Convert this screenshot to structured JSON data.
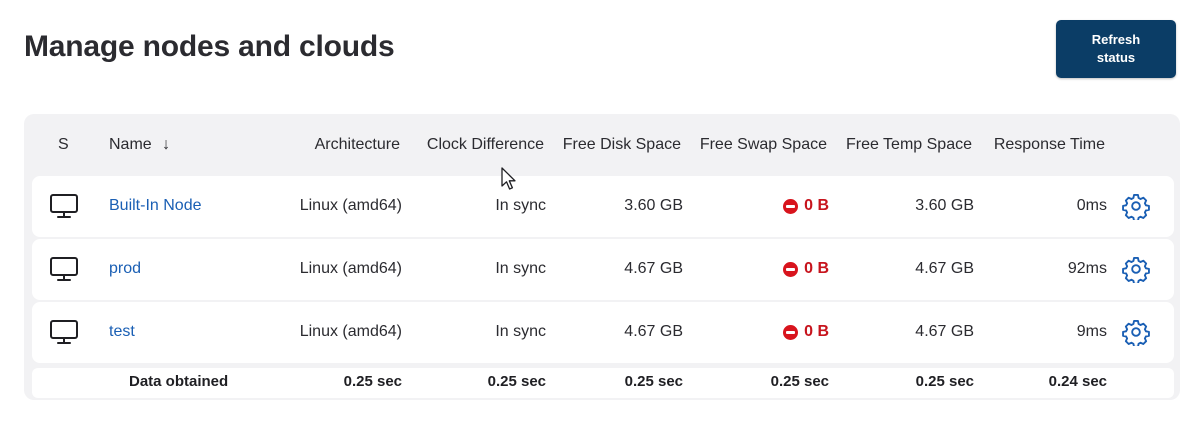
{
  "page": {
    "title": "Manage nodes and clouds",
    "refresh_label_line1": "Refresh",
    "refresh_label_line2": "status"
  },
  "table": {
    "columns": {
      "status": "S",
      "name": "Name",
      "sort_indicator": "↓",
      "architecture": "Architecture",
      "clock": "Clock Difference",
      "disk": "Free Disk Space",
      "swap": "Free Swap Space",
      "temp": "Free Temp Space",
      "response": "Response Time"
    },
    "rows": [
      {
        "name": "Built-In Node",
        "architecture": "Linux (amd64)",
        "clock": "In sync",
        "disk": "3.60 GB",
        "swap": "0 B",
        "temp": "3.60 GB",
        "response": "0ms"
      },
      {
        "name": "prod",
        "architecture": "Linux (amd64)",
        "clock": "In sync",
        "disk": "4.67 GB",
        "swap": "0 B",
        "temp": "4.67 GB",
        "response": "92ms"
      },
      {
        "name": "test",
        "architecture": "Linux (amd64)",
        "clock": "In sync",
        "disk": "4.67 GB",
        "swap": "0 B",
        "temp": "4.67 GB",
        "response": "9ms"
      }
    ],
    "footer": {
      "label": "Data obtained",
      "architecture": "0.25 sec",
      "clock": "0.25 sec",
      "disk": "0.25 sec",
      "swap": "0.25 sec",
      "temp": "0.25 sec",
      "response": "0.24 sec"
    }
  },
  "icons": {
    "node": "monitor-icon",
    "swap_warning": "stop-icon",
    "configure": "gear-icon",
    "cursor": "mouse-pointer-icon"
  },
  "colors": {
    "primary_button": "#0b3d66",
    "link": "#1a5fb4",
    "error": "#c7141d",
    "card_background": "#f2f2f4"
  }
}
